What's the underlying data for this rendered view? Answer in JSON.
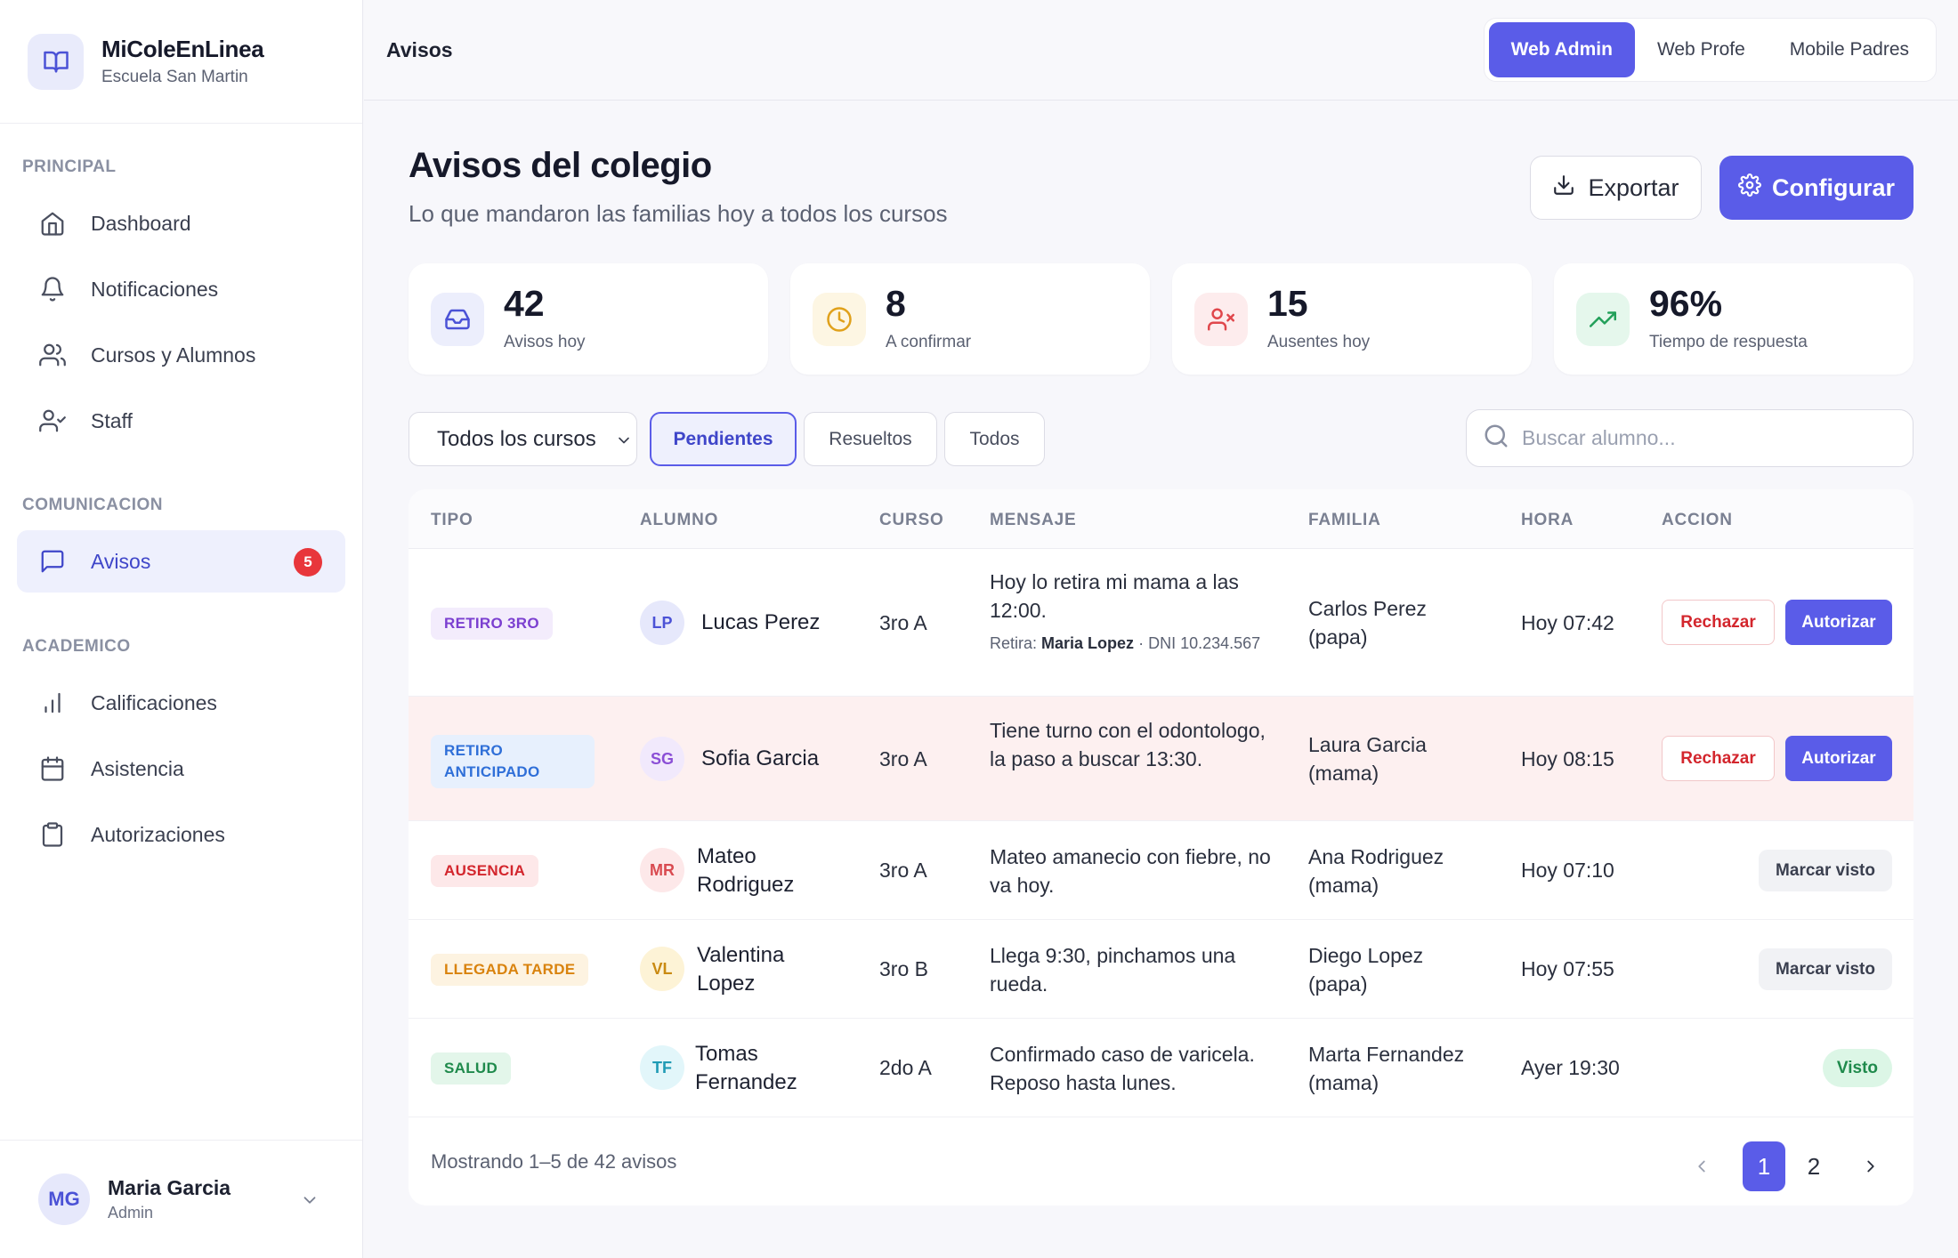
{
  "app": {
    "name": "MiColeEnLinea",
    "school": "Escuela San Martin"
  },
  "sidebar": {
    "sections": [
      {
        "title": "PRINCIPAL",
        "items": [
          {
            "label": "Dashboard",
            "icon": "home-icon"
          },
          {
            "label": "Notificaciones",
            "icon": "bell-icon"
          },
          {
            "label": "Cursos y Alumnos",
            "icon": "users-icon"
          },
          {
            "label": "Staff",
            "icon": "user-check-icon"
          }
        ]
      },
      {
        "title": "COMUNICACION",
        "items": [
          {
            "label": "Avisos",
            "icon": "message-icon",
            "active": true,
            "badge": "5"
          }
        ]
      },
      {
        "title": "ACADEMICO",
        "items": [
          {
            "label": "Calificaciones",
            "icon": "bar-chart-icon"
          },
          {
            "label": "Asistencia",
            "icon": "calendar-icon"
          },
          {
            "label": "Autorizaciones",
            "icon": "clipboard-icon"
          }
        ]
      }
    ],
    "user": {
      "initials": "MG",
      "name": "Maria Garcia",
      "role": "Admin"
    }
  },
  "topbar": {
    "title": "Avisos",
    "views": [
      {
        "label": "Web Admin",
        "active": true
      },
      {
        "label": "Web Profe",
        "active": false
      },
      {
        "label": "Mobile Padres",
        "active": false
      }
    ]
  },
  "header": {
    "title": "Avisos del colegio",
    "subtitle": "Lo que mandaron las familias hoy a todos los cursos",
    "export_label": "Exportar",
    "config_label": "Configurar"
  },
  "stats": [
    {
      "value": "42",
      "label": "Avisos hoy",
      "icon": "inbox-icon",
      "color": "#4b52d6",
      "bg": "#eceefc"
    },
    {
      "value": "8",
      "label": "A confirmar",
      "icon": "clock-icon",
      "color": "#e0a11b",
      "bg": "#fdf6e3"
    },
    {
      "value": "15",
      "label": "Ausentes hoy",
      "icon": "user-x-icon",
      "color": "#e0474c",
      "bg": "#fdeced"
    },
    {
      "value": "96%",
      "label": "Tiempo de respuesta",
      "icon": "trending-up-icon",
      "color": "#23a05a",
      "bg": "#e5f7ec"
    }
  ],
  "filters": {
    "course_select": "Todos los cursos",
    "chips": [
      {
        "label": "Pendientes",
        "active": true
      },
      {
        "label": "Resueltos",
        "active": false
      },
      {
        "label": "Todos",
        "active": false
      }
    ],
    "search_placeholder": "Buscar alumno..."
  },
  "table": {
    "columns": [
      "TIPO",
      "ALUMNO",
      "CURSO",
      "MENSAJE",
      "FAMILIA",
      "HORA",
      "ACCION"
    ],
    "rows": [
      {
        "type": "RETIRO 3RO",
        "type_color": "#7b3fd0",
        "type_bg": "#f3ecfc",
        "initials": "LP",
        "avatar_color": "#4b52d6",
        "avatar_bg": "#e6e8fb",
        "student": "Lucas Perez",
        "course": "3ro A",
        "message": "Hoy lo retira mi mama a las 12:00.",
        "note_prefix": "Retira:",
        "note_name": "Maria Lopez",
        "note_rest": "· DNI 10.234.567",
        "family": "Carlos Perez (papa)",
        "time": "Hoy 07:42",
        "action": "approve",
        "reject_label": "Rechazar",
        "approve_label": "Autorizar"
      },
      {
        "type": "RETIRO ANTICIPADO",
        "type_color": "#2f6fd8",
        "type_bg": "#e7f0fd",
        "initials": "SG",
        "avatar_color": "#8b4fd6",
        "avatar_bg": "#f1e9fc",
        "student": "Sofia Garcia",
        "course": "3ro A",
        "message": "Tiene turno con el odontologo, la paso a buscar 13:30.",
        "family": "Laura Garcia (mama)",
        "time": "Hoy 08:15",
        "action": "approve",
        "reject_label": "Rechazar",
        "approve_label": "Autorizar"
      },
      {
        "type": "AUSENCIA",
        "type_color": "#d3262d",
        "type_bg": "#fde8e9",
        "initials": "MR",
        "avatar_color": "#d94a50",
        "avatar_bg": "#fde8e9",
        "student": "Mateo Rodriguez",
        "course": "3ro A",
        "message": "Mateo amanecio con fiebre, no va hoy.",
        "family": "Ana Rodriguez (mama)",
        "time": "Hoy 07:10",
        "action": "seen",
        "seen_label": "Marcar visto"
      },
      {
        "type": "LLEGADA TARDE",
        "type_color": "#d9830e",
        "type_bg": "#fdf3e1",
        "initials": "VL",
        "avatar_color": "#c98a12",
        "avatar_bg": "#fdf3d6",
        "student": "Valentina Lopez",
        "course": "3ro B",
        "message": "Llega 9:30, pinchamos una rueda.",
        "family": "Diego Lopez (papa)",
        "time": "Hoy 07:55",
        "action": "seen",
        "seen_label": "Marcar visto"
      },
      {
        "type": "SALUD",
        "type_color": "#1f8a4c",
        "type_bg": "#e3f6ea",
        "initials": "TF",
        "avatar_color": "#1f9bb5",
        "avatar_bg": "#e2f6fa",
        "student": "Tomas Fernandez",
        "course": "2do A",
        "message": "Confirmado caso de varicela. Reposo hasta lunes.",
        "family": "Marta Fernandez (mama)",
        "time": "Ayer 19:30",
        "action": "done",
        "done_label": "Visto"
      }
    ],
    "footer": "Mostrando 1–5 de 42 avisos",
    "pages": [
      "1",
      "2"
    ],
    "current_page": "1"
  }
}
